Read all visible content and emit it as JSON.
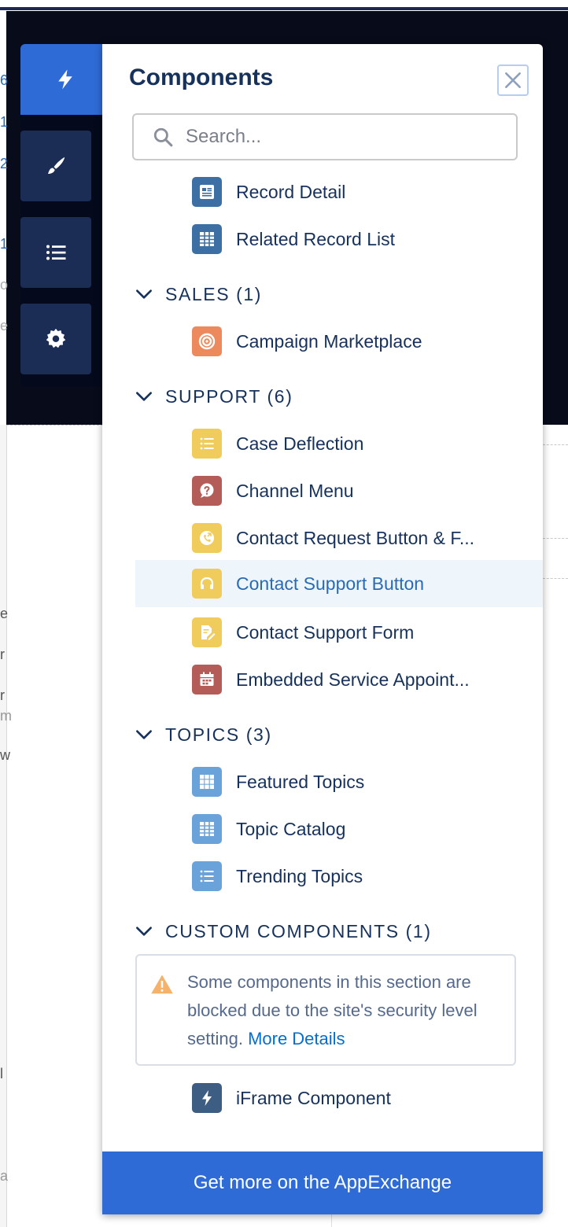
{
  "panel": {
    "title": "Components",
    "close_label": "×",
    "search_placeholder": "Search...",
    "footer_link": "Get more on the AppExchange"
  },
  "rail": {
    "items": [
      {
        "icon": "lightning-icon",
        "active": true
      },
      {
        "icon": "brush-icon",
        "active": false
      },
      {
        "icon": "list-icon",
        "active": false
      },
      {
        "icon": "gear-icon",
        "active": false
      }
    ]
  },
  "top_items": [
    {
      "label": "Record Detail",
      "icon": "record-detail-icon",
      "color": "#3c6fa3"
    },
    {
      "label": "Related Record List",
      "icon": "related-list-icon",
      "color": "#3c6fa3"
    }
  ],
  "sections": {
    "sales": {
      "title": "SALES (1)",
      "items": [
        {
          "label": "Campaign Marketplace",
          "icon": "target-icon",
          "color": "#ec8a5e"
        }
      ]
    },
    "support": {
      "title": "SUPPORT (6)",
      "items": [
        {
          "label": "Case Deflection",
          "icon": "list-icon",
          "color": "#f0cc5c"
        },
        {
          "label": "Channel Menu",
          "icon": "question-bubble-icon",
          "color": "#b35c58"
        },
        {
          "label": "Contact Request Button & F...",
          "icon": "phone-return-icon",
          "color": "#f0cc5c"
        },
        {
          "label": "Contact Support Button",
          "icon": "headset-icon",
          "color": "#f0cc5c"
        },
        {
          "label": "Contact Support Form",
          "icon": "form-edit-icon",
          "color": "#f0cc5c"
        },
        {
          "label": "Embedded Service Appoint...",
          "icon": "calendar-icon",
          "color": "#b35c58"
        }
      ]
    },
    "topics": {
      "title": "TOPICS (3)",
      "items": [
        {
          "label": "Featured Topics",
          "icon": "grid-icon",
          "color": "#6aa3d9"
        },
        {
          "label": "Topic Catalog",
          "icon": "table-icon",
          "color": "#6aa3d9"
        },
        {
          "label": "Trending Topics",
          "icon": "list-icon",
          "color": "#6aa3d9"
        }
      ]
    },
    "custom": {
      "title": "CUSTOM COMPONENTS (1)",
      "warning_text": "Some components in this section are blocked due to the site's security level setting.",
      "warning_link": "More Details",
      "items": [
        {
          "label": "iFrame Component",
          "icon": "lightning-icon",
          "color": "#3d5d82"
        }
      ]
    }
  },
  "background": {
    "left_fragments": [
      "6",
      "1",
      "2",
      "1",
      "o",
      "e",
      "e",
      "r",
      "r",
      "m",
      "w",
      "l",
      "a"
    ]
  }
}
